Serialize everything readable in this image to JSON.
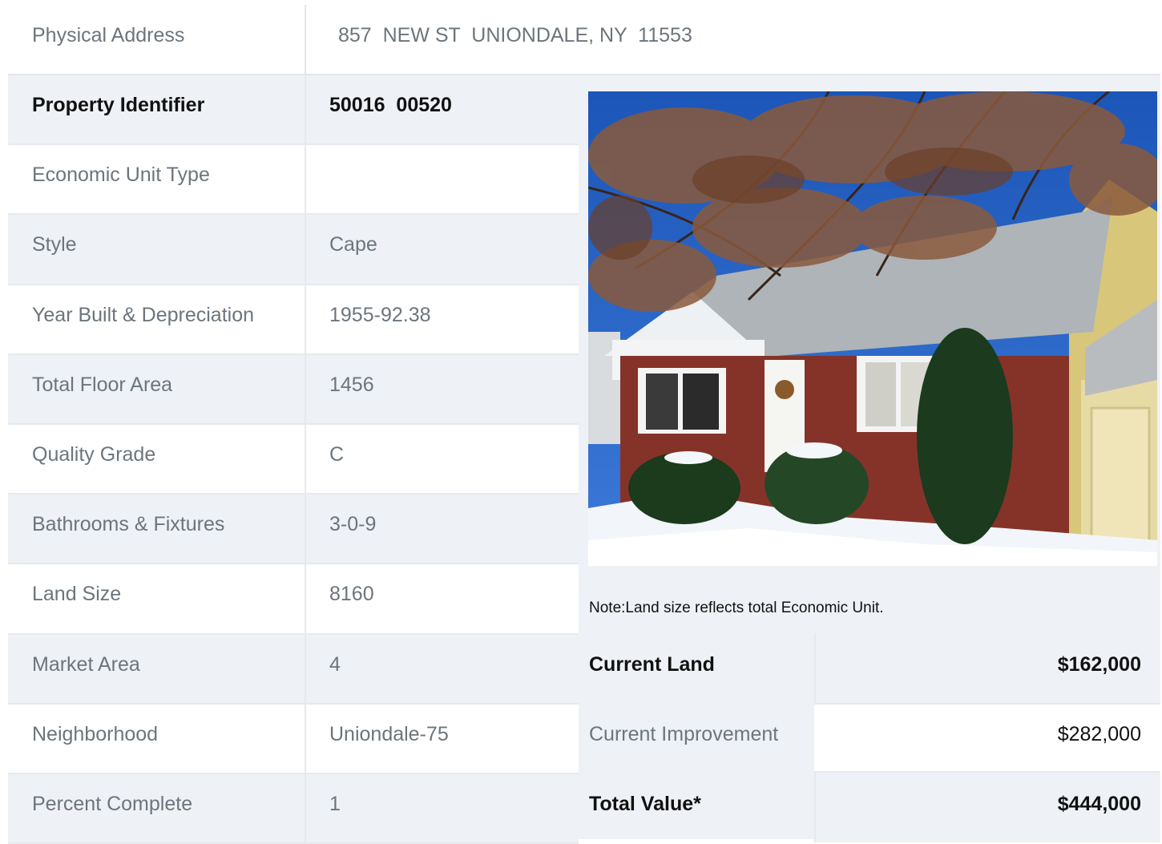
{
  "address": {
    "label": "Physical Address",
    "value": "857  NEW ST  UNIONDALE, NY  11553"
  },
  "details": [
    {
      "label": "Property Identifier",
      "value": "50016  00520",
      "bold": true
    },
    {
      "label": "Economic Unit Type",
      "value": ""
    },
    {
      "label": "Style",
      "value": "Cape"
    },
    {
      "label": "Year Built & Depreciation",
      "value": "1955-92.38"
    },
    {
      "label": "Total Floor Area",
      "value": "1456"
    },
    {
      "label": "Quality Grade",
      "value": "C"
    },
    {
      "label": "Bathrooms & Fixtures",
      "value": "3-0-9"
    },
    {
      "label": "Land Size",
      "value": "8160"
    },
    {
      "label": "Market Area",
      "value": "4"
    },
    {
      "label": "Neighborhood",
      "value": "Uniondale-75"
    },
    {
      "label": "Percent Complete",
      "value": "1"
    }
  ],
  "photo": {
    "subject": "house-photo"
  },
  "note": "Note:Land size reflects total Economic Unit.",
  "values": [
    {
      "label": "Current Land",
      "value": "$162,000",
      "bold": true
    },
    {
      "label": "Current Improvement",
      "value": "$282,000",
      "bold": false
    },
    {
      "label": "Total Value*",
      "value": "$444,000",
      "bold": true
    }
  ]
}
